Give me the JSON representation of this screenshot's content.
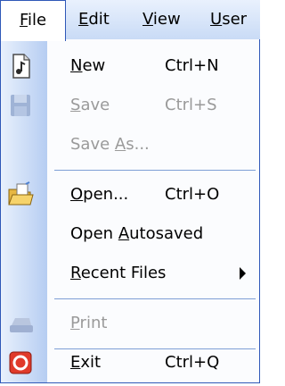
{
  "menubar": {
    "items": [
      {
        "label": "File",
        "mnemonic": "F",
        "rest": "ile"
      },
      {
        "label": "Edit",
        "mnemonic": "E",
        "rest": "dit"
      },
      {
        "label": "View",
        "mnemonic": "V",
        "rest": "iew"
      },
      {
        "label": "User",
        "mnemonic": "U",
        "rest": "ser"
      }
    ]
  },
  "file_menu": {
    "items": [
      {
        "icon": "new-document-icon",
        "mn": "N",
        "rest": "ew",
        "pre": "",
        "shortcut": "Ctrl+N",
        "enabled": true
      },
      {
        "icon": "save-disk-icon",
        "mn": "S",
        "rest": "ave",
        "pre": "",
        "shortcut": "Ctrl+S",
        "enabled": false
      },
      {
        "icon": "",
        "pre": "Save ",
        "mn": "A",
        "rest": "s...",
        "shortcut": "",
        "enabled": false
      },
      {
        "icon": "open-folder-icon",
        "mn": "O",
        "rest": "pen...",
        "pre": "",
        "shortcut": "Ctrl+O",
        "enabled": true
      },
      {
        "icon": "",
        "pre": "Open ",
        "mn": "A",
        "rest": "utosaved",
        "shortcut": "",
        "enabled": true
      },
      {
        "icon": "",
        "pre": "",
        "mn": "R",
        "rest": "ecent Files",
        "shortcut": "",
        "enabled": true,
        "submenu": true
      },
      {
        "icon": "printer-icon",
        "pre": "",
        "mn": "P",
        "rest": "rint",
        "shortcut": "",
        "enabled": false
      },
      {
        "icon": "exit-icon",
        "pre": "",
        "mn": "E",
        "rest": "xit",
        "shortcut": "Ctrl+Q",
        "enabled": true
      }
    ]
  },
  "colors": {
    "menubar_top": "#e9f1fd",
    "menubar_bottom": "#c9dbf6",
    "border": "#2f58b8",
    "separator": "#7e9fd6",
    "disabled_text": "#9a9a9a"
  }
}
